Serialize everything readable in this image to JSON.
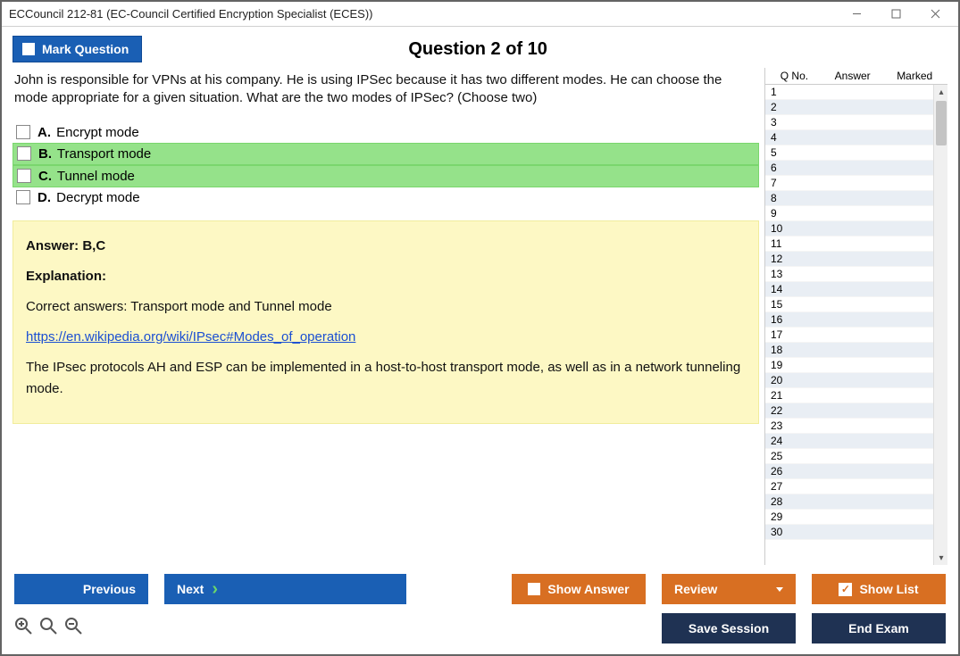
{
  "window": {
    "title": "ECCouncil 212-81 (EC-Council Certified Encryption Specialist (ECES))"
  },
  "topbar": {
    "mark_label": "Mark Question",
    "heading": "Question 2 of 10"
  },
  "question": {
    "text": "John is responsible for VPNs at his company. He is using IPSec because it has two different modes. He can choose the mode appropriate for a given situation. What are the two modes of IPSec? (Choose two)",
    "options": [
      {
        "letter": "A.",
        "text": "Encrypt mode",
        "correct": false
      },
      {
        "letter": "B.",
        "text": "Transport mode",
        "correct": true
      },
      {
        "letter": "C.",
        "text": "Tunnel mode",
        "correct": true
      },
      {
        "letter": "D.",
        "text": "Decrypt mode",
        "correct": false
      }
    ]
  },
  "answer": {
    "line": "Answer: B,C",
    "explanation_label": "Explanation:",
    "correct_line": "Correct answers: Transport mode and Tunnel mode",
    "link_text": "https://en.wikipedia.org/wiki/IPsec#Modes_of_operation",
    "detail": "The IPsec protocols AH and ESP can be implemented in a host-to-host transport mode, as well as in a network tunneling mode."
  },
  "qlist": {
    "header": {
      "qno": "Q No.",
      "answer": "Answer",
      "marked": "Marked"
    },
    "count": 30
  },
  "buttons": {
    "previous": "Previous",
    "next": "Next",
    "show_answer": "Show Answer",
    "review": "Review",
    "show_list": "Show List",
    "save_session": "Save Session",
    "end_exam": "End Exam"
  }
}
